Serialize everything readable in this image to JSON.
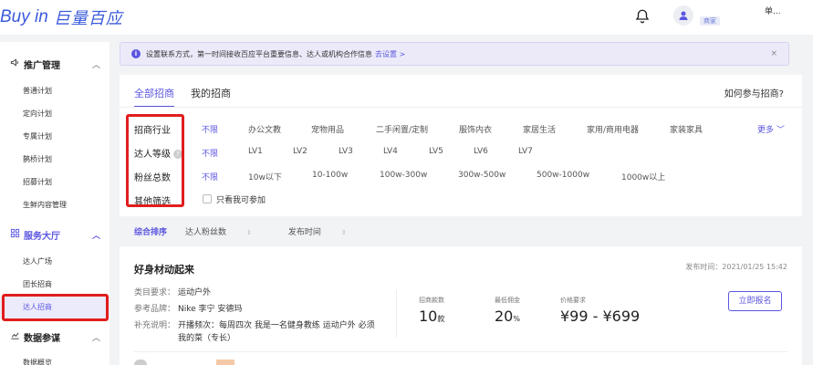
{
  "brand": {
    "name_en": "Buy in",
    "name_cn": "巨量百应",
    "color": "#3b5bdb"
  },
  "header": {
    "user_name": "单...",
    "user_badge": "商家",
    "bell_icon": "bell-icon",
    "avatar_icon": "user-avatar-icon"
  },
  "sidebar": {
    "groups": [
      {
        "label": "推广管理",
        "icon": "megaphone-icon",
        "items": [
          "普通计划",
          "定向计划",
          "专属计划",
          "鹊桥计划",
          "招募计划",
          "生鲜内容管理"
        ]
      },
      {
        "label": "服务大厅",
        "icon": "grid-icon",
        "items": [
          "达人广场",
          "团长招商",
          "达人招商"
        ]
      },
      {
        "label": "数据参谋",
        "icon": "chart-icon",
        "items": [
          "数据概览"
        ]
      }
    ],
    "active_item": "达人招商"
  },
  "notice": {
    "text": "设置联系方式，第一时间接收百应平台重要信息、达人或机构合作信息",
    "link": "去设置",
    "close": "×"
  },
  "tabs": [
    "全部招商",
    "我的招商"
  ],
  "active_tab": "全部招商",
  "help_link": "如何参与招商?",
  "filters": {
    "industry": {
      "label": "招商行业",
      "options": [
        "不限",
        "办公文教",
        "宠物用品",
        "二手闲置/定制",
        "服饰内衣",
        "家居生活",
        "家用/商用电器",
        "家装家具"
      ],
      "more": "更多"
    },
    "level": {
      "label": "达人等级",
      "options": [
        "不限",
        "LV1",
        "LV2",
        "LV3",
        "LV4",
        "LV5",
        "LV6",
        "LV7"
      ]
    },
    "fans": {
      "label": "粉丝总数",
      "options": [
        "不限",
        "10w以下",
        "10-100w",
        "100w-300w",
        "300w-500w",
        "500w-1000w",
        "1000w以上"
      ]
    },
    "other": {
      "label": "其他筛选",
      "checkbox": "只看我可参加",
      "checked": false
    }
  },
  "sort": {
    "options": [
      "综合排序",
      "达人粉丝数",
      "发布时间"
    ],
    "active": "综合排序"
  },
  "cards": [
    {
      "title": "好身材动起来",
      "publish_time": "发布时间：2021/01/25 15:42",
      "category_label": "类目要求：",
      "category": "运动户外",
      "brand_label": "参考品牌：",
      "brands": "Nike 李宁 安德玛",
      "desc_label": "补充说明：",
      "desc_line1": "开播频次：每周四次 我是一名健身教练 运动户外 必须",
      "desc_line2": "我的菜（专长）",
      "count_label": "招商款数",
      "count_value": "10",
      "count_unit": "款",
      "commission_label": "最低佣金",
      "commission_value": "20",
      "commission_unit": "%",
      "price_label": "价格要求",
      "price_value": "¥99 - ¥699",
      "signup": "立即报名"
    }
  ],
  "colors": {
    "accent": "#5b56e0",
    "highlight_border": "#e11d1d"
  }
}
